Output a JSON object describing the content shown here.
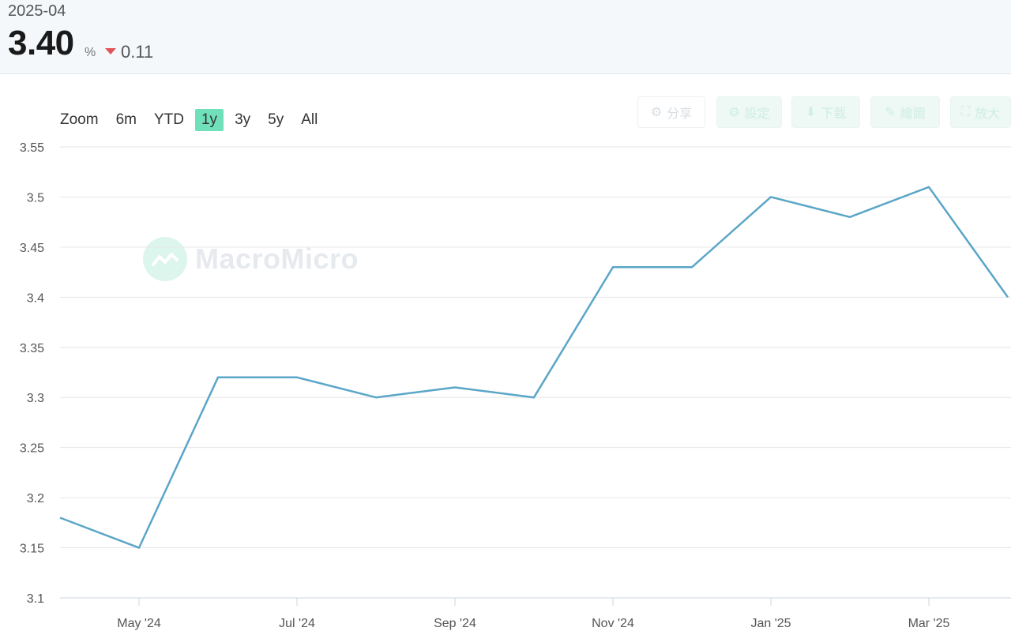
{
  "header": {
    "period": "2025-04",
    "value": "3.40",
    "unit": "%",
    "change": "0.11",
    "change_direction": "down",
    "change_color": "#e0555a"
  },
  "zoom": {
    "label": "Zoom",
    "options": [
      "6m",
      "YTD",
      "1y",
      "3y",
      "5y",
      "All"
    ],
    "active": "1y"
  },
  "toolbar": {
    "buttons": [
      {
        "icon": "share-icon",
        "label": "分享"
      },
      {
        "icon": "gear-icon",
        "label": "設定"
      },
      {
        "icon": "download-icon",
        "label": "下載"
      },
      {
        "icon": "pencil-icon",
        "label": "繪圖"
      },
      {
        "icon": "fullscreen-icon",
        "label": "放大"
      }
    ]
  },
  "watermark": {
    "text": "MacroMicro"
  },
  "chart_data": {
    "type": "line",
    "title": "",
    "xlabel": "",
    "ylabel": "",
    "ylim": [
      3.1,
      3.55
    ],
    "y_ticks": [
      "3.1",
      "3.15",
      "3.2",
      "3.25",
      "3.3",
      "3.35",
      "3.4",
      "3.45",
      "3.5",
      "3.55"
    ],
    "x_ticks": [
      "May '24",
      "Jul '24",
      "Sep '24",
      "Nov '24",
      "Jan '25",
      "Mar '25"
    ],
    "x_tick_dates": [
      "2024-05",
      "2024-07",
      "2024-09",
      "2024-11",
      "2025-01",
      "2025-03"
    ],
    "grid": true,
    "line_color": "#5aa6c8",
    "series": [
      {
        "x": [
          "2024-04",
          "2024-05",
          "2024-06",
          "2024-07",
          "2024-08",
          "2024-09",
          "2024-10",
          "2024-11",
          "2024-12",
          "2025-01",
          "2025-02",
          "2025-03",
          "2025-04"
        ],
        "values": [
          3.18,
          3.15,
          3.32,
          3.32,
          3.3,
          3.31,
          3.3,
          3.43,
          3.43,
          3.5,
          3.48,
          3.51,
          3.4
        ]
      }
    ]
  }
}
